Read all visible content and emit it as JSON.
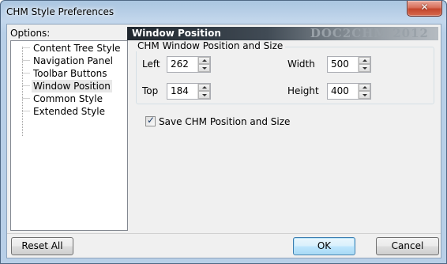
{
  "window": {
    "title": "CHM Style Preferences",
    "close_glyph": "✕"
  },
  "options": {
    "label": "Options:",
    "items": [
      {
        "label": "Content Tree Style"
      },
      {
        "label": "Navigation Panel"
      },
      {
        "label": "Toolbar Buttons"
      },
      {
        "label": "Window Position",
        "selected": true
      },
      {
        "label": "Common Style"
      },
      {
        "label": "Extended Style"
      }
    ]
  },
  "panel": {
    "header": "Window Position",
    "brand": "DOC2CHM 2012",
    "group_title": "CHM Window Position and Size",
    "left": {
      "label": "Left",
      "value": "262"
    },
    "top": {
      "label": "Top",
      "value": "184"
    },
    "width": {
      "label": "Width",
      "value": "500"
    },
    "height": {
      "label": "Height",
      "value": "400"
    },
    "save_position": {
      "label": "Save CHM Position and Size",
      "checked": true,
      "check_glyph": "✓"
    }
  },
  "buttons": {
    "reset": "Reset All",
    "ok": "OK",
    "cancel": "Cancel"
  },
  "colors": {
    "header_dark": "#20272e",
    "accent_blue": "#3c7fb1",
    "close_red": "#c4452c"
  }
}
